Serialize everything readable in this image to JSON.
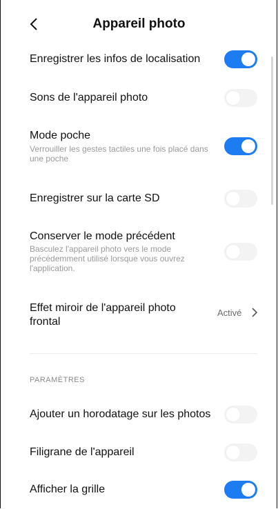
{
  "header": {
    "back_icon": "chevron-left-icon",
    "title": "Appareil photo"
  },
  "settings": [
    {
      "label": "Enregistrer les infos de localisation",
      "toggle": "on"
    },
    {
      "label": "Sons de l'appareil photo",
      "toggle": "off"
    },
    {
      "label": "Mode poche",
      "description": "Verrouiller les gestes tactiles une fois placé dans une poche",
      "toggle": "on"
    },
    {
      "label": "Enregistrer sur la carte SD",
      "toggle": "off"
    },
    {
      "label": "Conserver le mode précédent",
      "description": "Basculez l'appareil photo vers le mode précédemment utilisé lorsque vous ouvrez l'application.",
      "toggle": "off"
    },
    {
      "label": "Effet miroir de l'appareil photo frontal",
      "value": "Activé"
    }
  ],
  "section": {
    "title": "PARAMÈTRES",
    "items": [
      {
        "label": "Ajouter un horodatage sur les photos",
        "toggle": "off"
      },
      {
        "label": "Filigrane de l'appareil",
        "toggle": "off"
      },
      {
        "label": "Afficher la grille",
        "toggle": "on"
      }
    ]
  },
  "colors": {
    "accent": "#1e7cf2",
    "toggle_off": "#f3f3f3"
  }
}
